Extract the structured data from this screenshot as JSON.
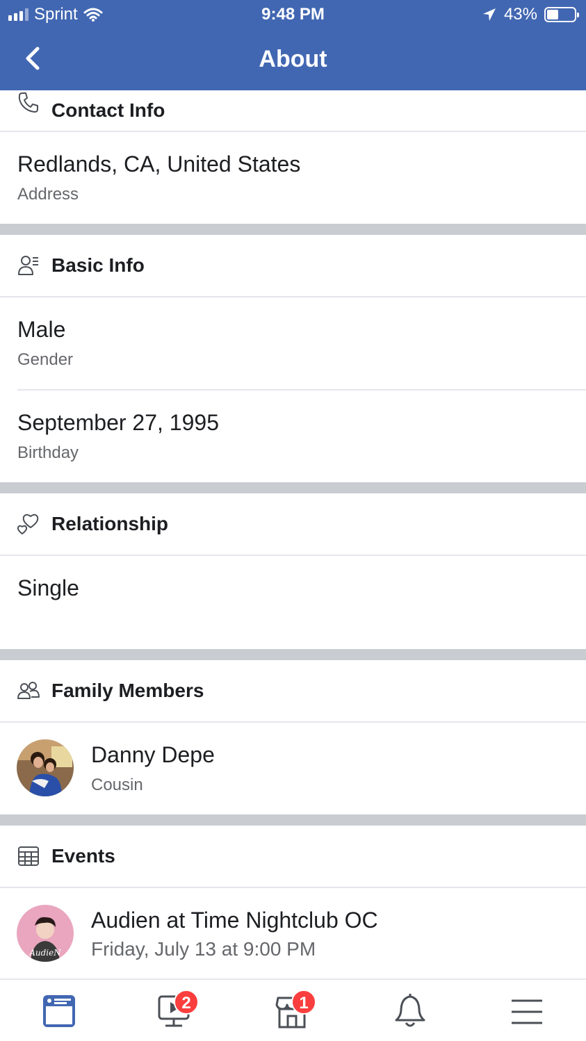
{
  "status_bar": {
    "carrier": "Sprint",
    "time": "9:48 PM",
    "battery_text": "43%",
    "battery_level": 0.43
  },
  "nav": {
    "title": "About"
  },
  "sections": {
    "contact": {
      "title": "Contact Info",
      "address_value": "Redlands, CA, United States",
      "address_label": "Address"
    },
    "basic": {
      "title": "Basic Info",
      "gender_value": "Male",
      "gender_label": "Gender",
      "birthday_value": "September 27, 1995",
      "birthday_label": "Birthday"
    },
    "relationship": {
      "title": "Relationship",
      "status_value": "Single"
    },
    "family": {
      "title": "Family Members",
      "member_name": "Danny Depe",
      "member_relation": "Cousin"
    },
    "events": {
      "title": "Events",
      "event_name": "Audien at Time Nightclub OC",
      "event_time": "Friday, July 13 at 9:00 PM",
      "event_avatar_text": "AudieN"
    }
  },
  "tabbar": {
    "watch_badge": "2",
    "marketplace_badge": "1"
  },
  "colors": {
    "brand": "#4267b2",
    "badge": "#fa3e3e",
    "separator": "#c9ccd1"
  }
}
